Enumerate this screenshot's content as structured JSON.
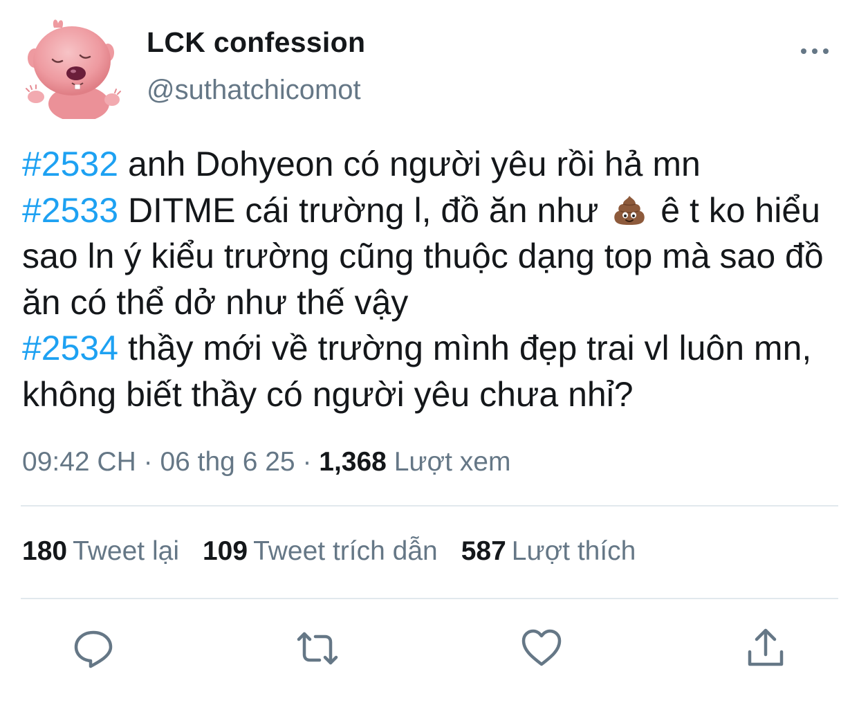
{
  "user": {
    "display_name": "LCK confession",
    "handle": "@suthatchicomot",
    "avatar_icon": "pink-beaver-avatar"
  },
  "tweet": {
    "paragraphs": [
      {
        "segments": [
          {
            "type": "hashtag",
            "text": "#2532"
          },
          {
            "type": "text",
            "text": " anh Dohyeon có người yêu rồi hả mn"
          }
        ]
      },
      {
        "segments": [
          {
            "type": "hashtag",
            "text": "#2533"
          },
          {
            "type": "text",
            "text": " DITME cái trường l, đồ ăn như "
          },
          {
            "type": "emoji",
            "name": "pile-of-poo-icon"
          },
          {
            "type": "text",
            "text": " ê t ko hiểu sao ln ý kiểu trường cũng thuộc dạng top mà sao đồ ăn có thể dở như thế vậy"
          }
        ]
      },
      {
        "segments": [
          {
            "type": "hashtag",
            "text": "#2534"
          },
          {
            "type": "text",
            "text": " thầy mới về trường mình đẹp trai vl luôn mn, không biết thầy có người yêu chưa nhỉ?"
          }
        ]
      }
    ]
  },
  "meta": {
    "time": "09:42 CH",
    "sep1": " · ",
    "date": "06 thg 6 25",
    "sep2": " · ",
    "views_count": "1,368",
    "views_label": " Lượt xem"
  },
  "stats": {
    "retweets_count": "180",
    "retweets_label": "Tweet lại",
    "quotes_count": "109",
    "quotes_label": "Tweet trích dẫn",
    "likes_count": "587",
    "likes_label": "Lượt thích"
  },
  "actions": [
    {
      "name": "reply-icon"
    },
    {
      "name": "retweet-icon"
    },
    {
      "name": "like-icon"
    },
    {
      "name": "share-icon"
    }
  ],
  "colors": {
    "hashtag": "#1da1f2",
    "secondary_text": "#657786",
    "primary_text": "#14171a",
    "divider": "#e1e8ed"
  }
}
